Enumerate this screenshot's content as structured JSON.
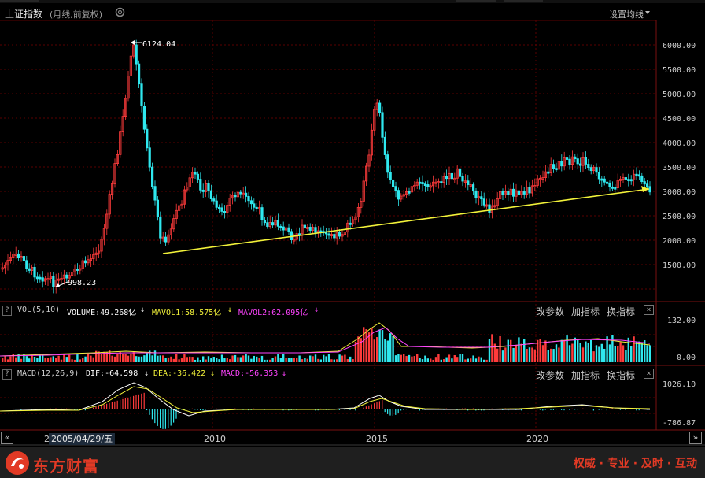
{
  "header": {
    "title": "上证指数",
    "subtitle": "(月线,前复权)",
    "settings_label": "设置均线"
  },
  "price_axis": {
    "ticks": [
      "6000.00",
      "5500.00",
      "5000.00",
      "4500.00",
      "4000.00",
      "3500.00",
      "3000.00",
      "2500.00",
      "2000.00",
      "1500.00"
    ],
    "max_label": "6124.04",
    "min_label": "998.23"
  },
  "volume_panel": {
    "indicator": "VOL(5,10)",
    "volume": "VOLUME:49.268亿",
    "mavol1": "MAVOL1:58.575亿",
    "mavol2": "MAVOL2:62.095亿",
    "ticks": [
      "132.00",
      "0.00"
    ]
  },
  "macd_panel": {
    "indicator": "MACD(12,26,9)",
    "dif": "DIF:-64.598",
    "dea": "DEA:-36.422",
    "macd": "MACD:-56.353",
    "ticks": [
      "1026.10",
      "-786.87"
    ]
  },
  "toolbar": {
    "params": "改参数",
    "add_indicator": "加指标",
    "switch_indicator": "换指标"
  },
  "time_axis": {
    "cursor_date": "2005/04/29/五",
    "partial_label": "20",
    "years": [
      "2010",
      "2015",
      "2020"
    ]
  },
  "footer": {
    "brand": "东方财富",
    "slogan": "权威 · 专业 · 及时 · 互动"
  },
  "colors": {
    "up": "#ff3b3b",
    "down": "#2fe8ef",
    "trend": "#f2f23a",
    "mavol1": "#f2f23a",
    "mavol2": "#ff44ff",
    "brand": "#e23a25"
  }
}
